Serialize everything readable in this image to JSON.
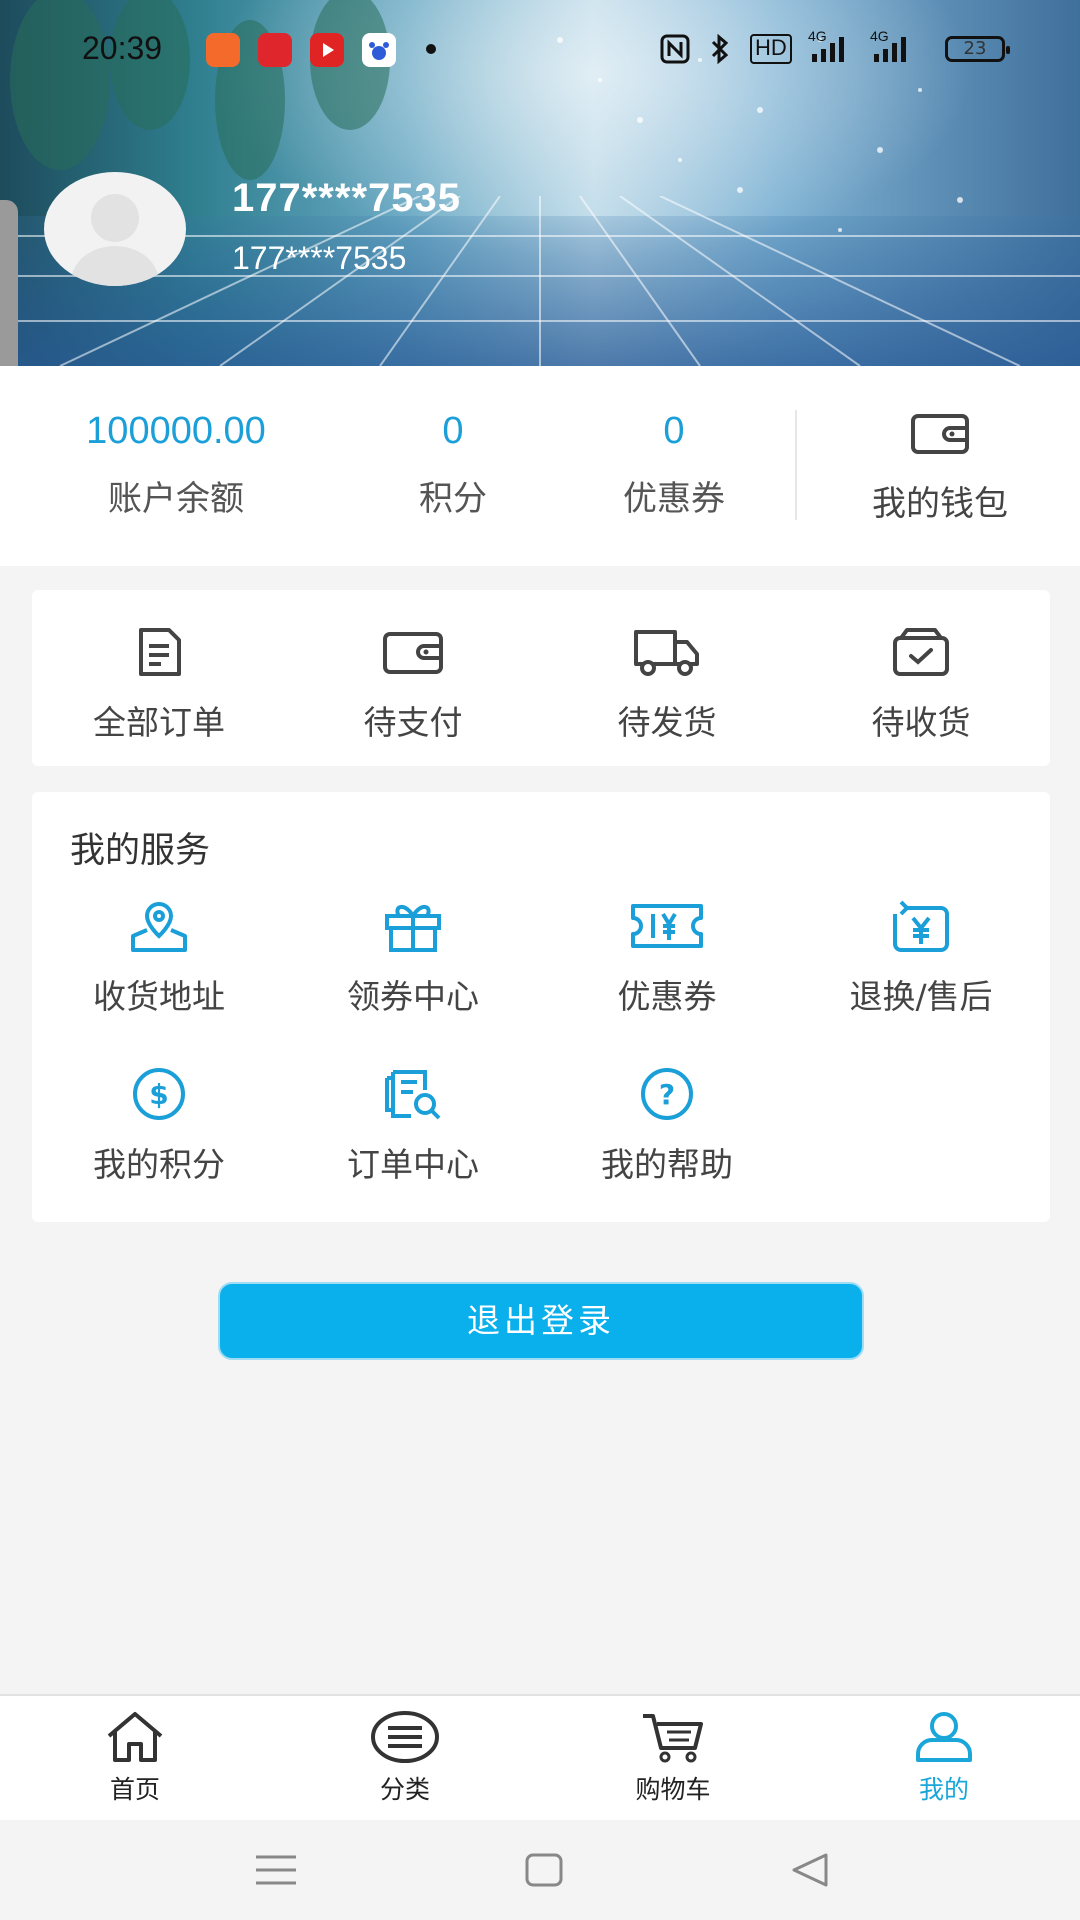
{
  "status_bar": {
    "time": "20:39",
    "signal_1": "4G",
    "signal_2": "4G",
    "hd": "HD",
    "battery": "23"
  },
  "profile": {
    "name": "177****7535",
    "phone": "177****7535"
  },
  "stats": {
    "balance_value": "100000.00",
    "balance_label": "账户余额",
    "points_value": "0",
    "points_label": "积分",
    "coupons_value": "0",
    "coupons_label": "优惠券",
    "wallet_label": "我的钱包"
  },
  "orders": {
    "items": [
      {
        "label": "全部订单",
        "icon": "document-icon"
      },
      {
        "label": "待支付",
        "icon": "wallet-icon"
      },
      {
        "label": "待发货",
        "icon": "truck-icon"
      },
      {
        "label": "待收货",
        "icon": "box-check-icon"
      }
    ]
  },
  "services": {
    "title": "我的服务",
    "items": [
      {
        "label": "收货地址",
        "icon": "location-icon"
      },
      {
        "label": "领券中心",
        "icon": "gift-icon"
      },
      {
        "label": "优惠券",
        "icon": "coupon-icon"
      },
      {
        "label": "退换/售后",
        "icon": "refund-icon"
      },
      {
        "label": "我的积分",
        "icon": "points-coin-icon"
      },
      {
        "label": "订单中心",
        "icon": "order-search-icon"
      },
      {
        "label": "我的帮助",
        "icon": "help-icon"
      }
    ]
  },
  "logout_label": "退出登录",
  "tabbar": {
    "items": [
      {
        "label": "首页",
        "icon": "home-icon"
      },
      {
        "label": "分类",
        "icon": "category-icon"
      },
      {
        "label": "购物车",
        "icon": "cart-icon"
      },
      {
        "label": "我的",
        "icon": "user-icon"
      }
    ],
    "active_index": 3
  },
  "colors": {
    "accent": "#1b9fd8",
    "button": "#0ab0ec"
  }
}
